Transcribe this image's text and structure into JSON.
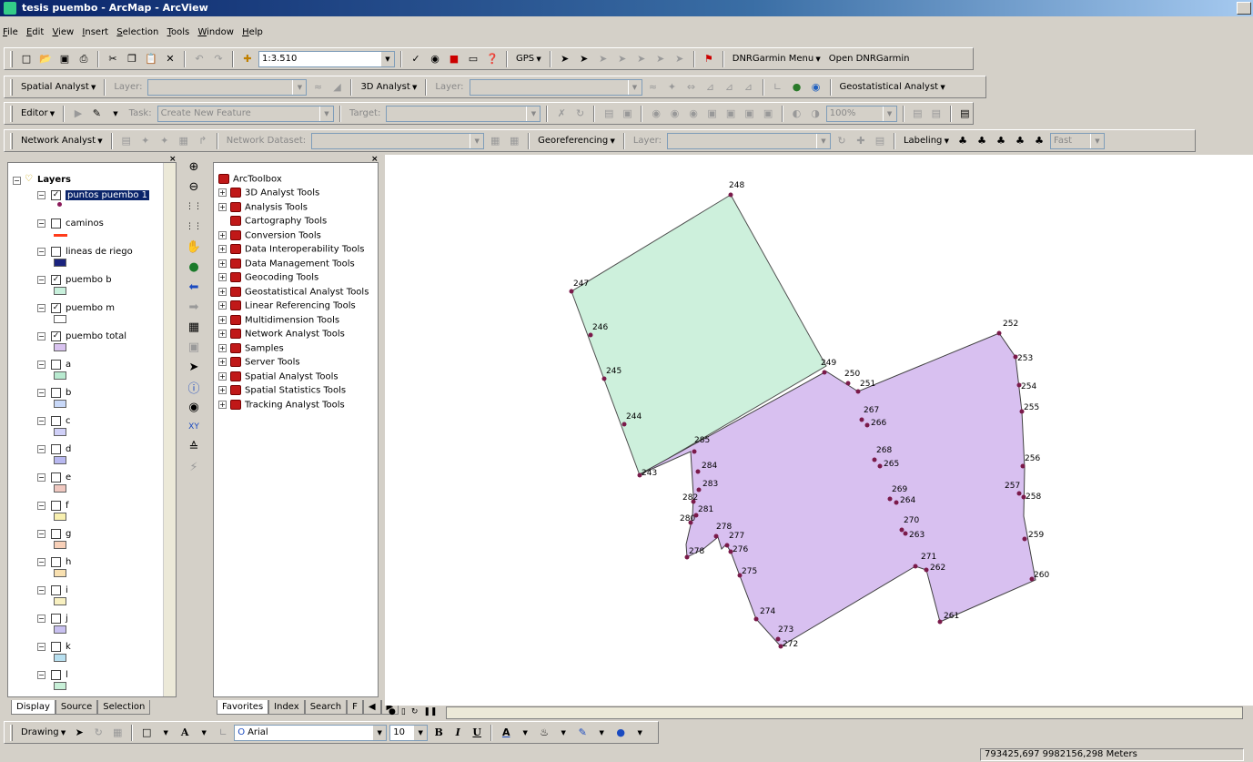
{
  "window": {
    "title": "tesis puembo - ArcMap - ArcView"
  },
  "menu": [
    "File",
    "Edit",
    "View",
    "Insert",
    "Selection",
    "Tools",
    "Window",
    "Help"
  ],
  "standard": {
    "scale": "1:3.510",
    "gps": "GPS",
    "dnr_menu": "DNRGarmin Menu",
    "dnr_open": "Open DNRGarmin"
  },
  "spatial": {
    "spatial_analyst": "Spatial Analyst",
    "layer_label": "Layer:",
    "analyst_3d": "3D Analyst",
    "layer_label2": "Layer:",
    "geostat": "Geostatistical Analyst"
  },
  "editor": {
    "editor": "Editor",
    "task_label": "Task:",
    "task_value": "Create New Feature",
    "target_label": "Target:",
    "zoom": "100%"
  },
  "network": {
    "network_analyst": "Network Analyst",
    "dataset_label": "Network Dataset:",
    "georef": "Georeferencing",
    "layer_label": "Layer:",
    "labeling": "Labeling",
    "fast": "Fast"
  },
  "toc": {
    "root": "Layers",
    "layers": [
      {
        "name": "puntos puembo 1",
        "checked": "✓",
        "swatch": "#8b1a5a",
        "type": "point"
      },
      {
        "name": "caminos",
        "checked": "",
        "swatch": "#ff3b1a",
        "type": "line"
      },
      {
        "name": "lineas de riego",
        "checked": "",
        "swatch": "#1a237e",
        "type": "fill"
      },
      {
        "name": "puembo b",
        "checked": "✓",
        "swatch": "#c8f0dc",
        "type": "fill"
      },
      {
        "name": "puembo m",
        "checked": "✓",
        "swatch": "#ffffff",
        "type": "fill"
      },
      {
        "name": "puembo total",
        "checked": "✓",
        "swatch": "#d9c3f0",
        "type": "fill"
      },
      {
        "name": "a",
        "checked": "",
        "swatch": "#b8ead0",
        "type": "fill"
      },
      {
        "name": "b",
        "checked": "",
        "swatch": "#c8d8f8",
        "type": "fill"
      },
      {
        "name": "c",
        "checked": "",
        "swatch": "#d0d0f8",
        "type": "fill"
      },
      {
        "name": "d",
        "checked": "",
        "swatch": "#b8b8f0",
        "type": "fill"
      },
      {
        "name": "e",
        "checked": "",
        "swatch": "#f0c8c0",
        "type": "fill"
      },
      {
        "name": "f",
        "checked": "",
        "swatch": "#f8f0b0",
        "type": "fill"
      },
      {
        "name": "g",
        "checked": "",
        "swatch": "#f8d0b8",
        "type": "fill"
      },
      {
        "name": "h",
        "checked": "",
        "swatch": "#f8e0b0",
        "type": "fill"
      },
      {
        "name": "i",
        "checked": "",
        "swatch": "#f8f0c0",
        "type": "fill"
      },
      {
        "name": "j",
        "checked": "",
        "swatch": "#c8c0f0",
        "type": "fill"
      },
      {
        "name": "k",
        "checked": "",
        "swatch": "#b8e0f0",
        "type": "fill"
      },
      {
        "name": "l",
        "checked": "",
        "swatch": "#c8f0d8",
        "type": "fill"
      }
    ],
    "tabs": [
      "Display",
      "Source",
      "Selection"
    ]
  },
  "toolbox": {
    "root": "ArcToolbox",
    "tools": [
      "3D Analyst Tools",
      "Analysis Tools",
      "Cartography Tools",
      "Conversion Tools",
      "Data Interoperability Tools",
      "Data Management Tools",
      "Geocoding Tools",
      "Geostatistical Analyst Tools",
      "Linear Referencing Tools",
      "Multidimension Tools",
      "Network Analyst Tools",
      "Samples",
      "Server Tools",
      "Spatial Analyst Tools",
      "Spatial Statistics Tools",
      "Tracking Analyst Tools"
    ],
    "tabs": [
      "Favorites",
      "Index",
      "Search",
      "F"
    ]
  },
  "drawing": {
    "drawing": "Drawing",
    "font": "Arial",
    "size": "10"
  },
  "status": {
    "coords": "793425,697  9982156,298 Meters"
  },
  "map": {
    "colors": {
      "green": "#cdf0dc",
      "purple": "#d8c0f0",
      "edge": "#404040",
      "point": "#7a1a4a"
    },
    "points": [
      {
        "id": "243"
      },
      {
        "id": "244"
      },
      {
        "id": "245"
      },
      {
        "id": "246"
      },
      {
        "id": "247"
      },
      {
        "id": "248"
      },
      {
        "id": "249"
      },
      {
        "id": "250"
      },
      {
        "id": "251"
      },
      {
        "id": "252"
      },
      {
        "id": "253"
      },
      {
        "id": "254"
      },
      {
        "id": "255"
      },
      {
        "id": "256"
      },
      {
        "id": "257"
      },
      {
        "id": "258"
      },
      {
        "id": "259"
      },
      {
        "id": "260"
      },
      {
        "id": "261"
      },
      {
        "id": "262"
      },
      {
        "id": "263"
      },
      {
        "id": "264"
      },
      {
        "id": "265"
      },
      {
        "id": "266"
      },
      {
        "id": "267"
      },
      {
        "id": "268"
      },
      {
        "id": "269"
      },
      {
        "id": "270"
      },
      {
        "id": "271"
      },
      {
        "id": "272"
      },
      {
        "id": "273"
      },
      {
        "id": "274"
      },
      {
        "id": "275"
      },
      {
        "id": "276"
      },
      {
        "id": "277"
      },
      {
        "id": "278"
      },
      {
        "id": "278"
      },
      {
        "id": "280"
      },
      {
        "id": "281"
      },
      {
        "id": "282"
      },
      {
        "id": "283"
      },
      {
        "id": "284"
      },
      {
        "id": "285"
      }
    ]
  }
}
